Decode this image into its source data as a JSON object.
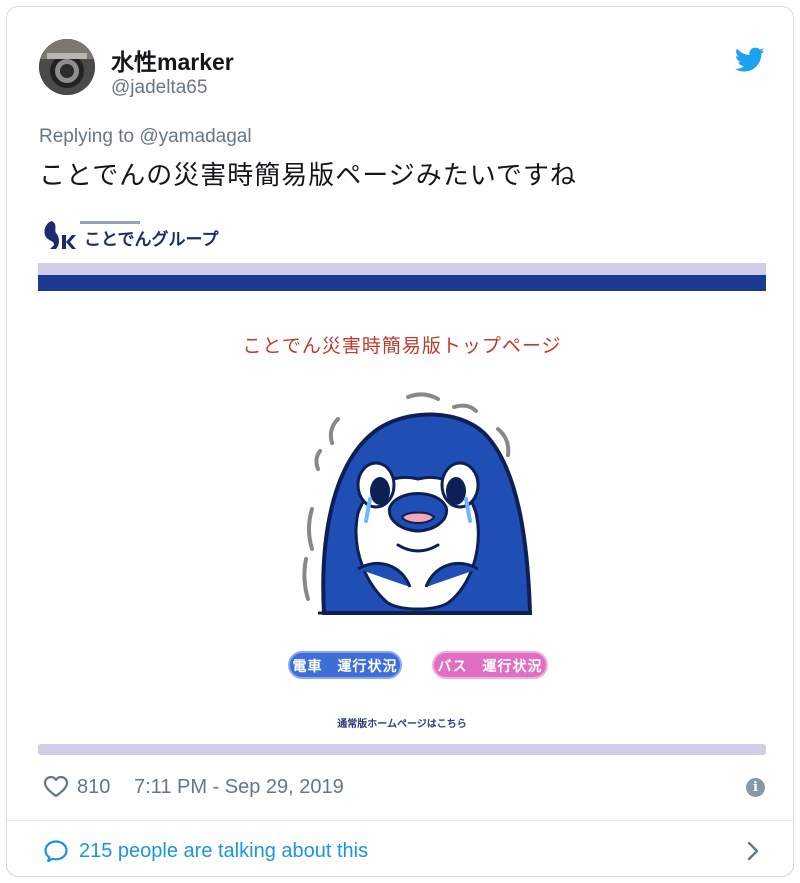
{
  "author": {
    "display_name": "水性marker",
    "handle": "@jadelta65"
  },
  "reply": {
    "prefix": "Replying to ",
    "target": "@yamadagal"
  },
  "tweet_text": "ことでんの災害時簡易版ページみたいですね",
  "media": {
    "logo_text": "ことでんグループ",
    "title": "ことでん災害時簡易版トップページ",
    "train_button": "電車　運行状況",
    "bus_button": "バス　運行状況",
    "home_link": "通常版ホームページはこちら",
    "colors": {
      "band_dark": "#1a3b8f",
      "band_light": "#cfcde8",
      "title_red": "#c0392b",
      "train_blue": "#3f6fd6",
      "bus_pink": "#e06fc4"
    }
  },
  "stats": {
    "likes": "810",
    "timestamp": "7:11 PM - Sep 29, 2019"
  },
  "conversation": {
    "label": "215 people are talking about this"
  },
  "icons": {
    "brand": "twitter-bird-icon",
    "like": "heart-icon",
    "info": "info-icon",
    "reply": "chat-bubble-icon",
    "more": "chevron-right-icon"
  },
  "colors": {
    "text_primary": "#14171a",
    "text_secondary": "#657786",
    "twitter_blue": "#1da1f2",
    "link_blue": "#1b95e0"
  }
}
